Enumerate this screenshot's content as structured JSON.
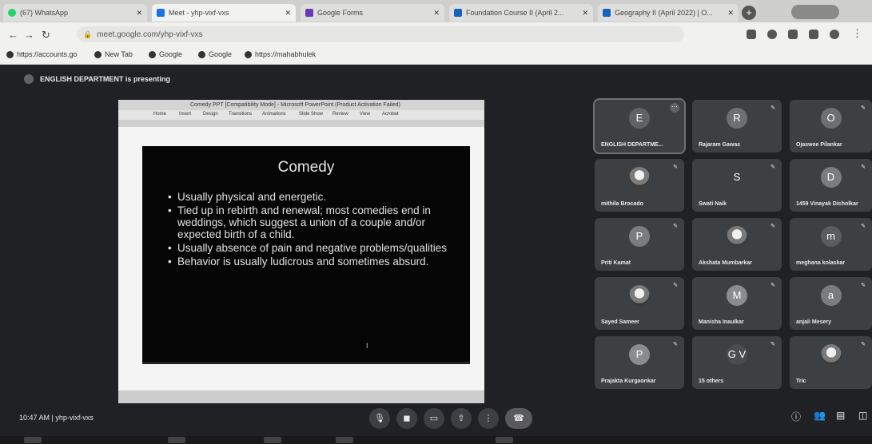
{
  "tabs": [
    {
      "label": "(67) WhatsApp",
      "color": "#25d366"
    },
    {
      "label": "Meet - yhp-vixf-vxs",
      "color": "#1a73e8"
    },
    {
      "label": "Google Forms",
      "color": "#673ab7"
    },
    {
      "label": "Foundation Course II (April 2...",
      "color": "#1565c0"
    },
    {
      "label": "Geography II (April 2022) | O...",
      "color": "#1565c0"
    }
  ],
  "address": {
    "url": "meet.google.com/yhp-vixf-vxs"
  },
  "bookmarks": [
    "https://accounts.go",
    "New Tab",
    "Google",
    "Google",
    "https://mahabhulek"
  ],
  "meet": {
    "presenting": "ENGLISH DEPARTMENT is presenting",
    "pp_title": "Comedy PPT [Compatibility Mode] - Microsoft PowerPoint (Product Activation Failed)",
    "pp_menu": [
      "Home",
      "Insert",
      "Design",
      "Transitions",
      "Animations",
      "Slide Show",
      "Review",
      "View",
      "Acrobat"
    ],
    "slide": {
      "title": "Comedy",
      "bullets": [
        "Usually physical and energetic.",
        "Tied up in rebirth and renewal; most comedies end in weddings, which suggest a union of a couple and/or expected birth of a child.",
        "Usually absence of pain and negative problems/qualities",
        "Behavior is usually ludicrous and sometimes absurd."
      ]
    },
    "participants": [
      {
        "name": "ENGLISH DEPARTME...",
        "initial": "E",
        "color": "#5f6368"
      },
      {
        "name": "Rajaram Gawas",
        "initial": "R",
        "color": "#6d6f73"
      },
      {
        "name": "Ojaswee Pilankar",
        "initial": "O",
        "color": "#6d6f73"
      },
      {
        "name": "mithila Brocado",
        "initial": "",
        "color": "#ffffff"
      },
      {
        "name": "Swati Naik",
        "initial": "S",
        "color": "#3c4043"
      },
      {
        "name": "1459 Vinayak Dicholkar",
        "initial": "D",
        "color": "#7a7c80"
      },
      {
        "name": "Priti Kamat",
        "initial": "P",
        "color": "#7a7c80"
      },
      {
        "name": "Akshata Mumbarkar",
        "initial": "",
        "color": "#ffffff"
      },
      {
        "name": "meghana kolaskar",
        "initial": "m",
        "color": "#5a5c60"
      },
      {
        "name": "Sayed Sameer",
        "initial": "",
        "color": "#9a9a9a"
      },
      {
        "name": "Manisha Inaulkar",
        "initial": "M",
        "color": "#8a8c90"
      },
      {
        "name": "anjali Mesery",
        "initial": "a",
        "color": "#7a7c80"
      },
      {
        "name": "Prajakta Kurgaonkar",
        "initial": "P",
        "color": "#8a8c90"
      },
      {
        "name": "15 others",
        "initial": "G V",
        "color": "#4a4c50"
      },
      {
        "name": "Tric",
        "initial": "",
        "color": "#4a4c50"
      }
    ],
    "clock": "10:47 AM | yhp-vixf-vxs"
  }
}
